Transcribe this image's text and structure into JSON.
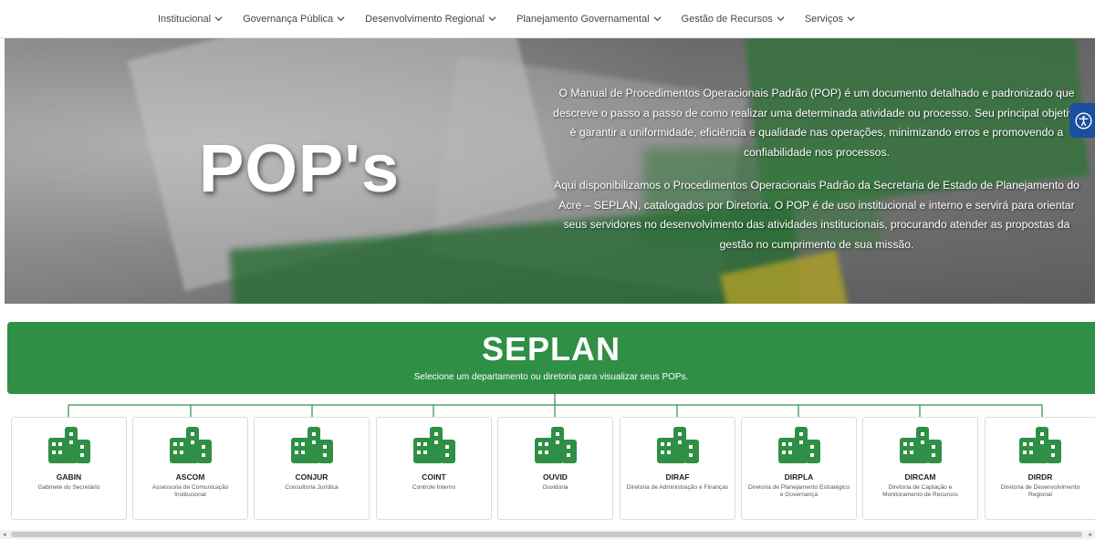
{
  "nav": {
    "items": [
      {
        "label": "Institucional"
      },
      {
        "label": "Governança Pública"
      },
      {
        "label": "Desenvolvimento Regional"
      },
      {
        "label": "Planejamento Governamental"
      },
      {
        "label": "Gestão de Recursos"
      },
      {
        "label": "Serviços"
      }
    ]
  },
  "hero": {
    "title": "POP's",
    "paragraph1": "O Manual de Procedimentos Operacionais Padrão (POP) é um documento detalhado e padronizado que descreve o passo a passo de como realizar uma determinada atividade ou processo. Seu principal objetivo é garantir a uniformidade, eficiência e qualidade nas operações, minimizando erros e promovendo a confiabilidade nos processos.",
    "paragraph2": "Aqui disponibilizamos o Procedimentos Operacionais Padrão da Secretaria de Estado de Planejamento do Acre – SEPLAN, catalogados por Diretoria. O POP é de uso institucional e interno e servirá para orientar seus servidores no desenvolvimento das atividades institucionais, procurando atender as propostas da gestão no cumprimento de sua missão."
  },
  "banner": {
    "title": "SEPLAN",
    "subtitle": "Selecione um departamento ou diretoria para visualizar seus POPs."
  },
  "departments": [
    {
      "abbr": "GABIN",
      "name": "Gabinete do Secretário"
    },
    {
      "abbr": "ASCOM",
      "name": "Assessoria de Comunicação Institucional"
    },
    {
      "abbr": "CONJUR",
      "name": "Consultoria Jurídica"
    },
    {
      "abbr": "COINT",
      "name": "Controle Interno"
    },
    {
      "abbr": "OUVID",
      "name": "Ouvidoria"
    },
    {
      "abbr": "DIRAF",
      "name": "Diretoria de Administração e Finanças"
    },
    {
      "abbr": "DIRPLA",
      "name": "Diretoria de Planejamento Estratégico e Governança"
    },
    {
      "abbr": "DIRCAM",
      "name": "Diretoria de Captação e Monitoramento de Recursos"
    },
    {
      "abbr": "DIRDR",
      "name": "Diretoria de Desenvolvimento Regional"
    }
  ],
  "colors": {
    "brand_green": "#2f8f45",
    "accessibility_blue": "#1a4fa0"
  },
  "icons": {
    "nav_dropdown": "chevron-down-icon",
    "department": "building-icon",
    "accessibility": "accessibility-icon"
  }
}
